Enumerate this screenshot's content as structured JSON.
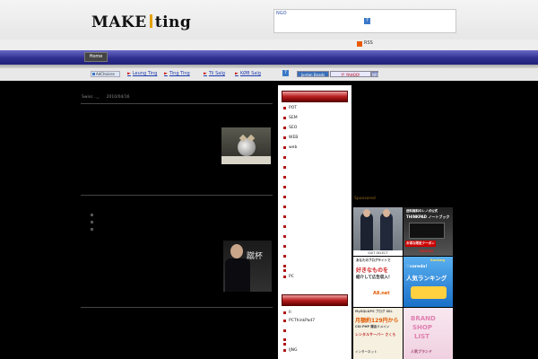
{
  "header": {
    "logo_left": "MAKE",
    "logo_right": "ting",
    "ad_label": "NGO",
    "ad_question": "?",
    "rss_label": "RSS"
  },
  "nav": {
    "home_label": "Home"
  },
  "links_bar": {
    "adchoices_label": "AdChoices",
    "links": [
      {
        "label": "Leung Ting"
      },
      {
        "label": "Ting Ting"
      },
      {
        "label": "Til Salg"
      },
      {
        "label": "KØB Salg"
      }
    ],
    "question": "?",
    "badges": [
      "Jordan Beads",
      "Y! YAHOO!",
      "NRS"
    ]
  },
  "post": {
    "meta_author": "Swiss .._.",
    "meta_date": "2010/04/16"
  },
  "banner": {
    "text": "蹴杯"
  },
  "sidebar": {
    "categories": [
      "POT",
      "SEM",
      "SEO",
      "WEB",
      "web",
      "",
      "",
      "",
      "",
      "",
      "",
      "",
      "",
      "",
      "",
      "",
      "",
      "",
      "PC"
    ],
    "archives": [
      "II",
      "PCThinkPad7",
      "",
      "",
      "",
      "IJNG"
    ]
  },
  "sponsors": {
    "label": "Sponsored",
    "ad1_text": "SUIT SELECT",
    "ad2_lines": [
      "送料無料のレノボ公式",
      "THINKPAD ノートブック",
      "お得な限定クーポン",
      "lenovo"
    ],
    "ad3_lines": [
      "あなたのブログサイトで",
      "好きなものを",
      "紹介して広告収入!",
      "A8.net"
    ],
    "ad4_lines": [
      "Ranking",
      "♡coreda!",
      "人気ランキング"
    ],
    "ad5_lines": [
      "MySQL&PS ブログ SSL",
      "月額約129円から",
      "CGI PHP 獨自ドメイン",
      "レンタルサーバー さくら",
      "インターネット"
    ],
    "ad6_lines": [
      "BRAND",
      "SHOP",
      "LIST",
      "人気ブランド"
    ]
  },
  "colors": {
    "nav": "#2e2e8e",
    "side_head": "#b82020",
    "link": "#1c3cb0"
  }
}
